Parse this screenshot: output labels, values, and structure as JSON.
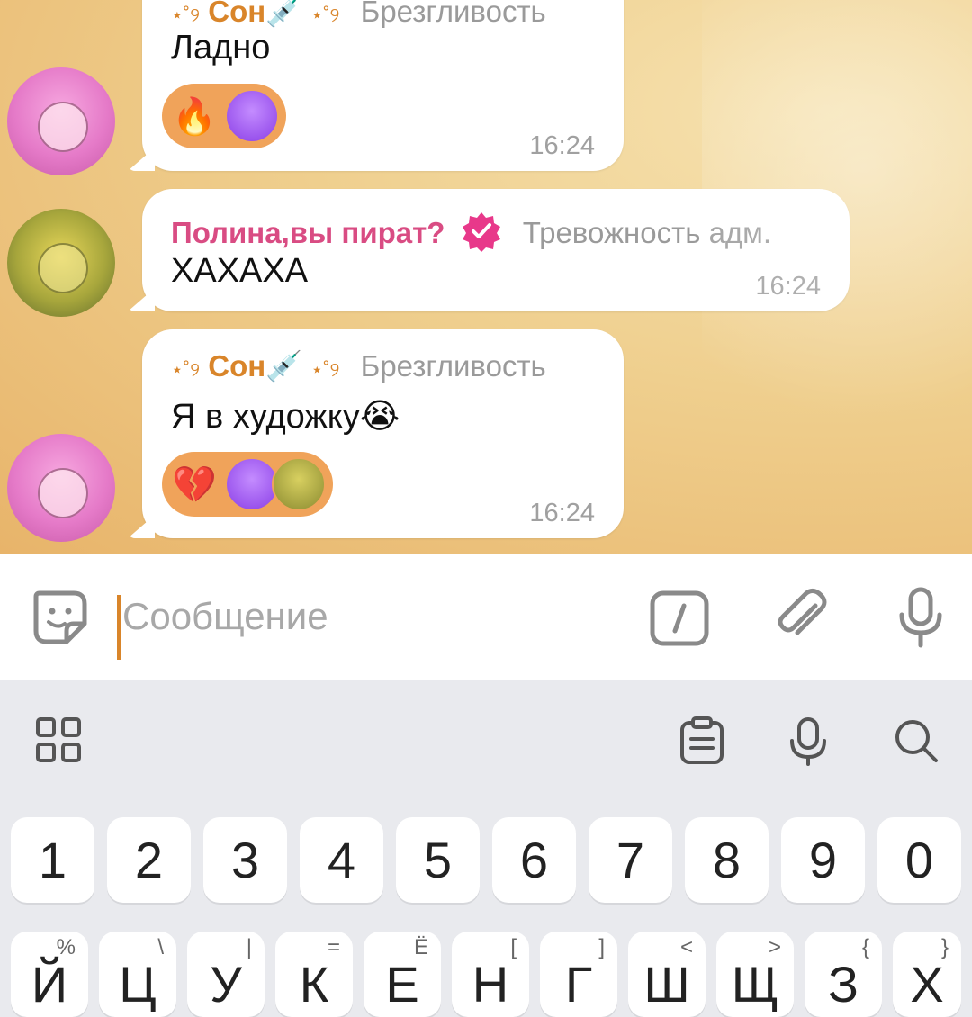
{
  "messages": [
    {
      "sender": "Сон",
      "sender_deco_left": "⋆˚୨",
      "sender_deco_right": "⋆˚୨",
      "sender_emoji": "💉",
      "role": "Брезгливость",
      "text": "Ладно",
      "time": "16:24",
      "reactions": [
        "🔥"
      ]
    },
    {
      "sender": "Полина,вы пират?",
      "role": "Тревожность адм.",
      "text": "ХАХАХА",
      "time": "16:24"
    },
    {
      "sender": "Сон",
      "sender_deco_left": "⋆˚୨",
      "sender_deco_right": "⋆˚୨",
      "sender_emoji": "💉",
      "role": "Брезгливость",
      "text": "Я в художку😭",
      "time": "16:24",
      "reactions": [
        "💔"
      ]
    }
  ],
  "input": {
    "placeholder": "Сообщение"
  },
  "keyboard": {
    "number_row": [
      "1",
      "2",
      "3",
      "4",
      "5",
      "6",
      "7",
      "8",
      "9",
      "0"
    ],
    "letter_row_partial": [
      "Й",
      "Ц",
      "У",
      "К",
      "Е",
      "Н",
      "Г",
      "Ш",
      "Щ",
      "З",
      "Х"
    ],
    "letter_row_subs": [
      "%",
      "\\",
      "|",
      "=",
      "Ё",
      "[",
      "]",
      "<",
      ">",
      "{",
      "}"
    ]
  },
  "colors": {
    "accent": "#d9852a",
    "polina_name": "#d94c83",
    "reaction_bg": "#f0a35a"
  }
}
